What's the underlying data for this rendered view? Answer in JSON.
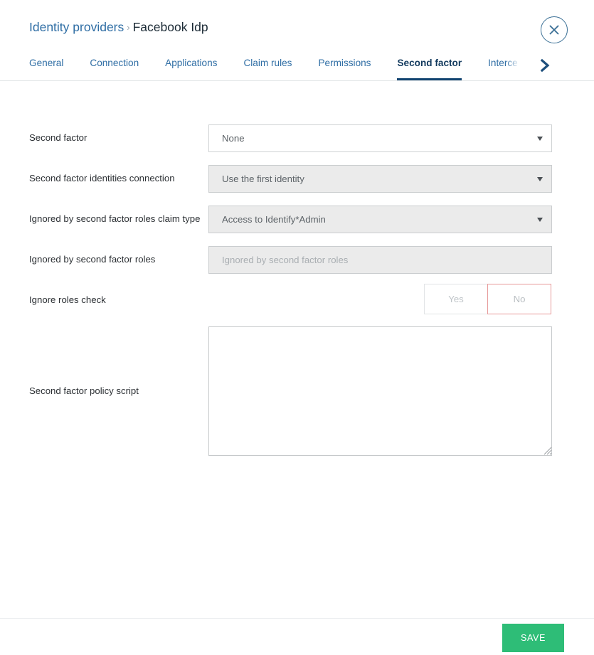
{
  "header": {
    "breadcrumb_parent": "Identity providers",
    "breadcrumb_separator": "›",
    "breadcrumb_current": "Facebook Idp",
    "close_icon": "close-circle-icon"
  },
  "tabs": {
    "items": [
      {
        "label": "General",
        "active": false
      },
      {
        "label": "Connection",
        "active": false
      },
      {
        "label": "Applications",
        "active": false
      },
      {
        "label": "Claim rules",
        "active": false
      },
      {
        "label": "Permissions",
        "active": false
      },
      {
        "label": "Second factor",
        "active": true
      },
      {
        "label": "Interce",
        "active": false
      }
    ],
    "scroll_right_icon": "chevron-right-icon"
  },
  "form": {
    "fields": [
      {
        "label": "Second factor",
        "value": "None",
        "placeholder": "",
        "type": "select",
        "disabled": false
      },
      {
        "label": "Second factor identities connection",
        "value": "Use the first identity",
        "placeholder": "",
        "type": "select",
        "disabled": true
      },
      {
        "label": "Ignored by second factor roles claim type",
        "value": "Access to Identify*Admin",
        "placeholder": "",
        "type": "select",
        "disabled": true
      },
      {
        "label": "Ignored by second factor roles",
        "value": "",
        "placeholder": "Ignored by second factor roles",
        "type": "text",
        "disabled": true
      }
    ],
    "toggle": {
      "label": "Ignore roles check",
      "yes_label": "Yes",
      "no_label": "No",
      "selected": "No"
    },
    "script": {
      "label": "Second factor policy script",
      "value": "",
      "placeholder": ""
    }
  },
  "footer": {
    "save_label": "SAVE"
  },
  "colors": {
    "link": "#2e6da4",
    "tab_active": "#123a5e",
    "tab_underline": "#114370",
    "close_border": "#3b7096",
    "save_green": "#2ebd77",
    "selected_toggle_border": "#e79a9a",
    "disabled_field_bg": "#ebebeb",
    "chevron": "#1d4f7c"
  }
}
